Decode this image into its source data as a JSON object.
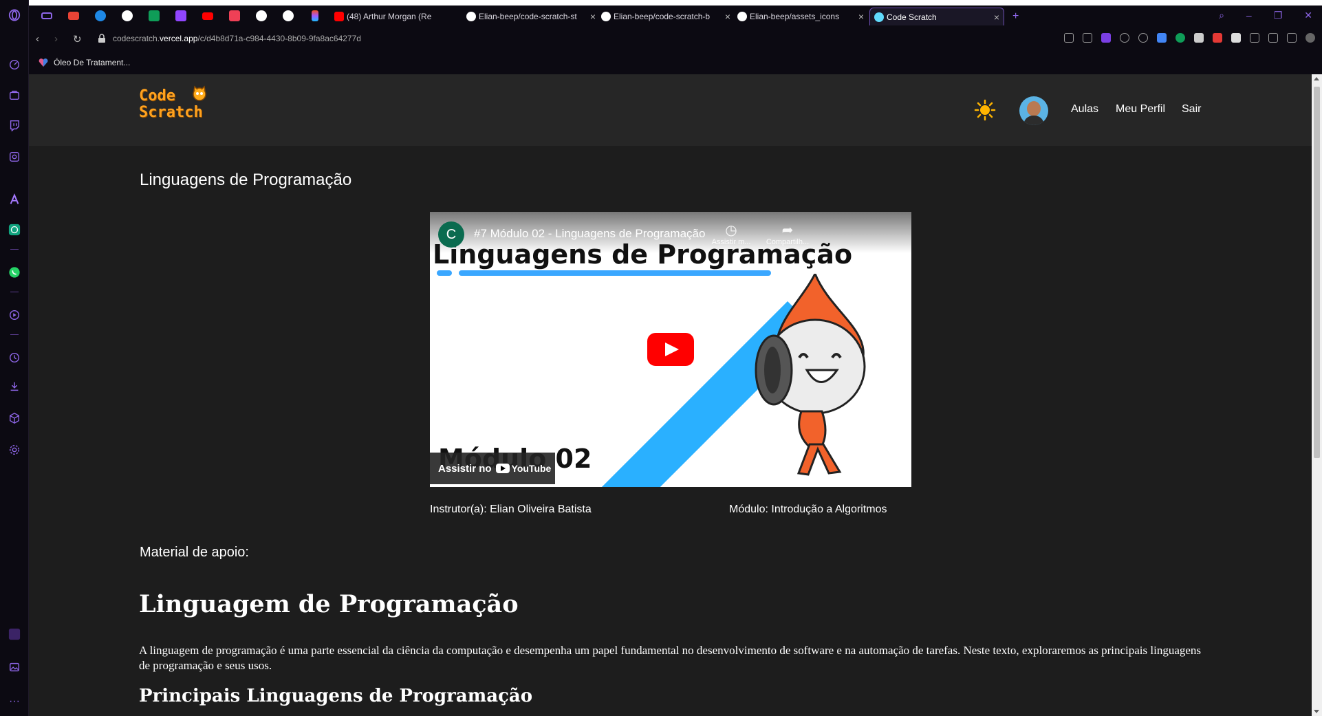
{
  "browser": {
    "tabs": [
      {
        "label": "(48) Arthur Morgan (Re"
      },
      {
        "label": "Elian-beep/code-scratch-st"
      },
      {
        "label": "Elian-beep/code-scratch-b"
      },
      {
        "label": "Elian-beep/assets_icons"
      },
      {
        "label": "Code Scratch"
      }
    ],
    "url_prefix": "codescratch.",
    "url_domain": "vercel.app",
    "url_path": "/c/d4b8d71a-c984-4430-8b09-9fa8ac64277d",
    "bookmark": "Óleo De Tratament..."
  },
  "site": {
    "logo_line1": "Code",
    "logo_line2": "Scratch",
    "nav": {
      "aulas": "Aulas",
      "perfil": "Meu Perfil",
      "sair": "Sair"
    },
    "lesson_title": "Linguagens de Programação",
    "video": {
      "channel_initial": "C",
      "title": "#7 Módulo 02 - Linguagens de Programação",
      "thumb_title": "Linguagens de Programação",
      "thumb_module": "Módulo 02",
      "watch_later": "Assistir m...",
      "share": "Compartilh...",
      "watch_on": "Assistir no",
      "youtube": "YouTube"
    },
    "instructor": "Instrutor(a): Elian Oliveira Batista",
    "module": "Módulo: Introdução a Algoritmos",
    "support_title": "Material de apoio:",
    "article_h1": "Linguagem de Programação",
    "article_p": "A linguagem de programação é uma parte essencial da ciência da computação e desempenha um papel fundamental no desenvolvimento de software e na automação de tarefas. Neste texto, exploraremos as principais linguagens de programação e seus usos.",
    "article_h2": "Principais Linguagens de Programação"
  },
  "colors": {
    "accent": "#8e66e8",
    "logo": "#ffa21f",
    "page_bg": "#1d1d1d",
    "header_bg": "#262626"
  }
}
